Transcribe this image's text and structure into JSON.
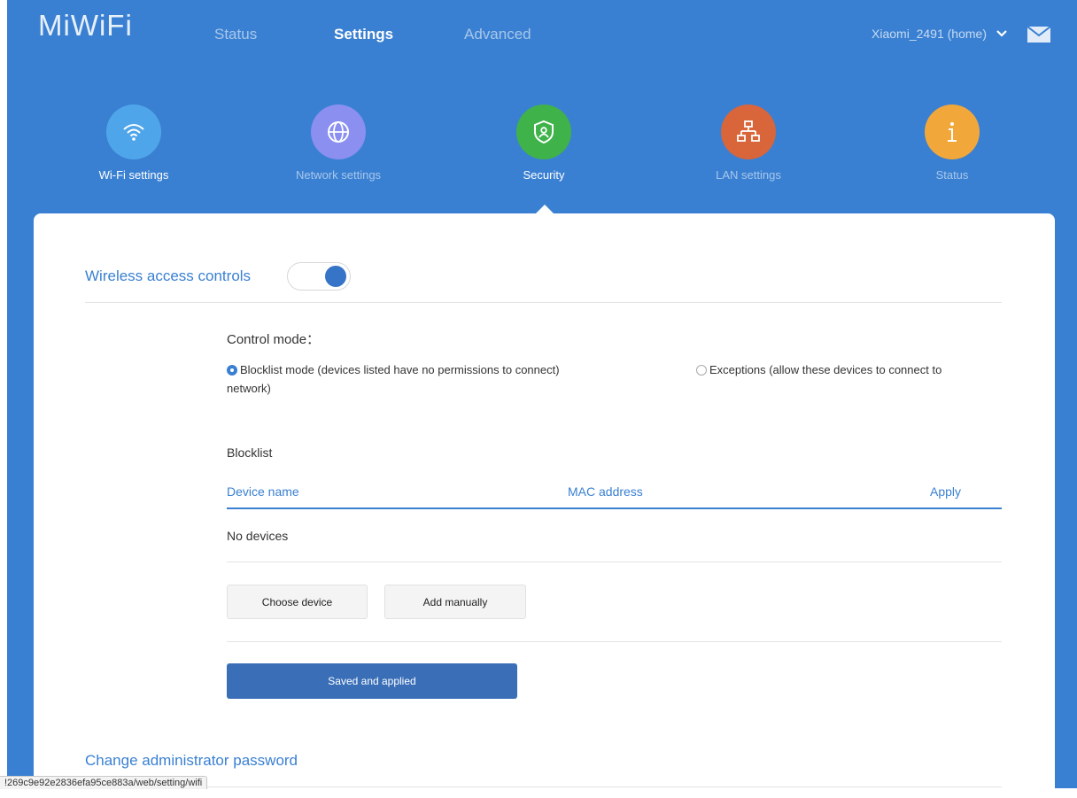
{
  "header": {
    "logo": "MiWiFi",
    "nav": [
      {
        "label": "Status"
      },
      {
        "label": "Settings"
      },
      {
        "label": "Advanced"
      }
    ],
    "user": "Xiaomi_2491 (home)"
  },
  "categories": [
    {
      "label": "Wi-Fi settings",
      "color": "#4fa5ea",
      "icon": "wifi-icon"
    },
    {
      "label": "Network settings",
      "color": "#8a8ff0",
      "icon": "globe-icon"
    },
    {
      "label": "Security",
      "color": "#3fb24a",
      "icon": "shield-icon"
    },
    {
      "label": "LAN settings",
      "color": "#d9653a",
      "icon": "network-tree-icon"
    },
    {
      "label": "Status",
      "color": "#f2a73a",
      "icon": "info-icon"
    }
  ],
  "wireless": {
    "title": "Wireless access controls",
    "toggle_on": true,
    "control_mode_label": "Control mode：",
    "mode_blocklist_line1": "Blocklist mode (devices listed have no permissions to connect)",
    "mode_blocklist_line2": "network)",
    "mode_exceptions": "Exceptions (allow these devices to connect to",
    "selected_mode": "blocklist",
    "blocklist_title": "Blocklist",
    "columns": [
      "Device name",
      "MAC address",
      "Apply"
    ],
    "empty_text": "No devices",
    "choose_device": "Choose device",
    "add_manually": "Add manually",
    "save_button": "Saved and applied"
  },
  "admin": {
    "title": "Change administrator password"
  },
  "statusbar": {
    "url": "!269c9e92e2836efa95ce883a/web/setting/wifi"
  },
  "colors": {
    "accent": "#3a80d2",
    "primary_button": "#3a6fb8"
  }
}
